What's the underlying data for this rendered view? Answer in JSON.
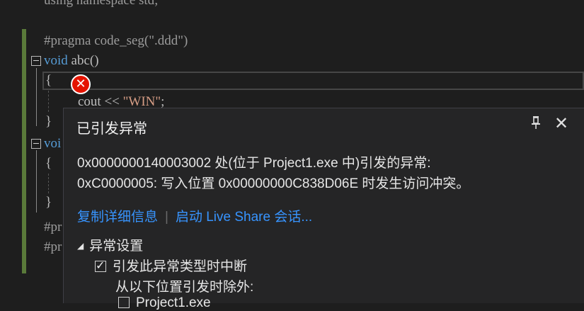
{
  "editor": {
    "line_using": "using namespace std;",
    "line_pragma": "#pragma code_seg(\".ddd\")",
    "func_abc": {
      "kw": "void",
      "name": " abc()"
    },
    "open_brace": "{",
    "close_brace": "}",
    "cout_line": {
      "code": "cout << ",
      "str": "\"WIN\"",
      "end": ";"
    },
    "void2_partial": "voi",
    "brace2_open": "{",
    "brace2_close": "}",
    "pr1_partial": "#pr",
    "pr2_partial": "#pr"
  },
  "exception_popup": {
    "title": "已引发异常",
    "message_line1": "0x0000000140003002 处(位于 Project1.exe 中)引发的异常:",
    "message_line2": "0xC0000005: 写入位置 0x00000000C838D06E 时发生访问冲突。",
    "link_copy": "复制详细信息",
    "link_liveshare": "启动 Live Share 会话...",
    "section_title": "异常设置",
    "option_break": "引发此异常类型时中断",
    "option_except_label": "从以下位置引发时除外:",
    "option_project": "Project1.exe"
  },
  "colors": {
    "background": "#1e1e1e",
    "popup_bg": "#252526",
    "link": "#3794ff",
    "error_icon": "#e51400",
    "keyword": "#569cd6",
    "string": "#d69d85"
  }
}
